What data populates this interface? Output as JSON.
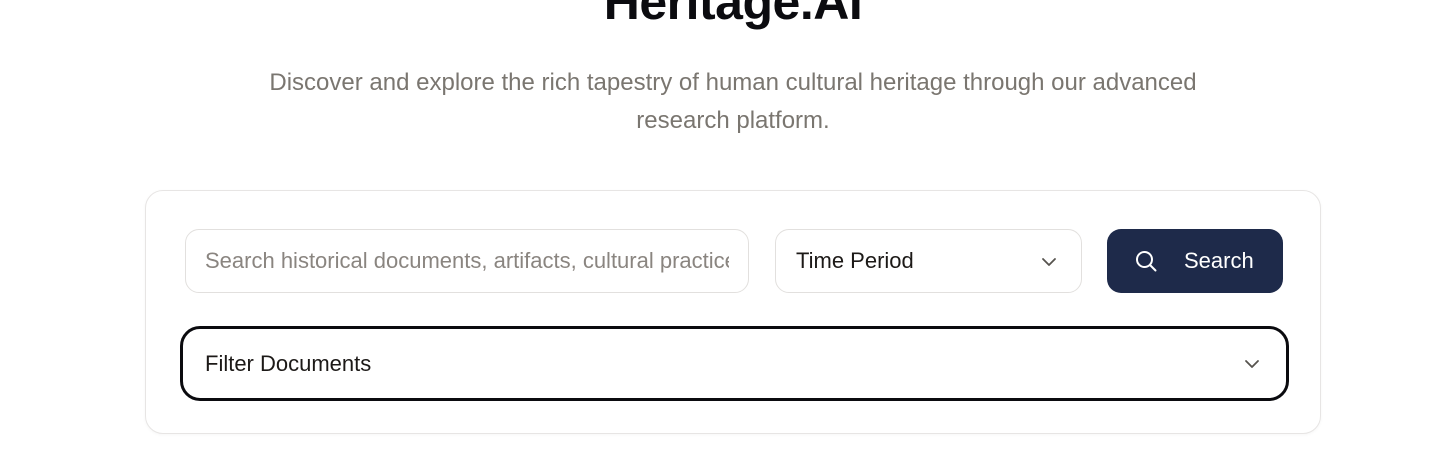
{
  "hero": {
    "title": "Heritage.AI",
    "subtitle": "Discover and explore the rich tapestry of human cultural heritage through our advanced research platform."
  },
  "search": {
    "placeholder": "Search historical documents, artifacts, cultural practices...",
    "value": "",
    "time_period_label": "Time Period",
    "button_label": "Search",
    "button_icon": "search-icon",
    "filter_label": "Filter Documents",
    "dropdown_icon": "chevron-down-icon"
  },
  "colors": {
    "accent": "#1e2a4a",
    "subtitle": "#7a7670",
    "border": "#e2e0de",
    "focus_border": "#0b0b0f"
  }
}
